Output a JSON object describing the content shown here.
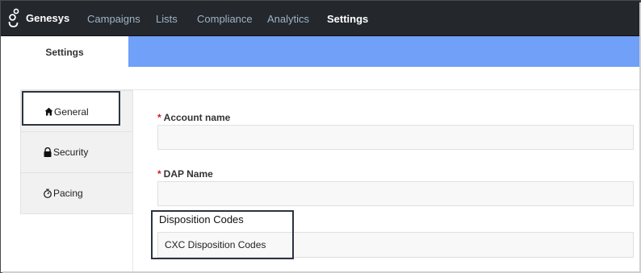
{
  "app": {
    "brand": "Genesys",
    "logo_icon": "genesys-logo-icon"
  },
  "nav": {
    "items": [
      {
        "label": "Campaigns",
        "active": false
      },
      {
        "label": "Lists",
        "active": false
      },
      {
        "label": "Compliance",
        "active": false
      },
      {
        "label": "Analytics",
        "active": false
      },
      {
        "label": "Settings",
        "active": true
      }
    ]
  },
  "tabs": {
    "active_label": "Settings"
  },
  "sidebar": {
    "items": [
      {
        "label": "General",
        "icon": "home-icon",
        "active": true
      },
      {
        "label": "Security",
        "icon": "lock-icon",
        "active": false
      },
      {
        "label": "Pacing",
        "icon": "stopwatch-icon",
        "active": false
      }
    ]
  },
  "form": {
    "account_name": {
      "label": "Account name",
      "required_mark": "*",
      "value": ""
    },
    "dap_name": {
      "label": "DAP Name",
      "required_mark": "*",
      "value": ""
    },
    "disposition_codes": {
      "label": "Disposition Codes",
      "value": "CXC Disposition Codes"
    }
  },
  "colors": {
    "topnav_bg": "#24272b",
    "tab_band": "#70a0f8",
    "required": "#d01a1a",
    "nav_inactive": "#9fb3c8"
  }
}
